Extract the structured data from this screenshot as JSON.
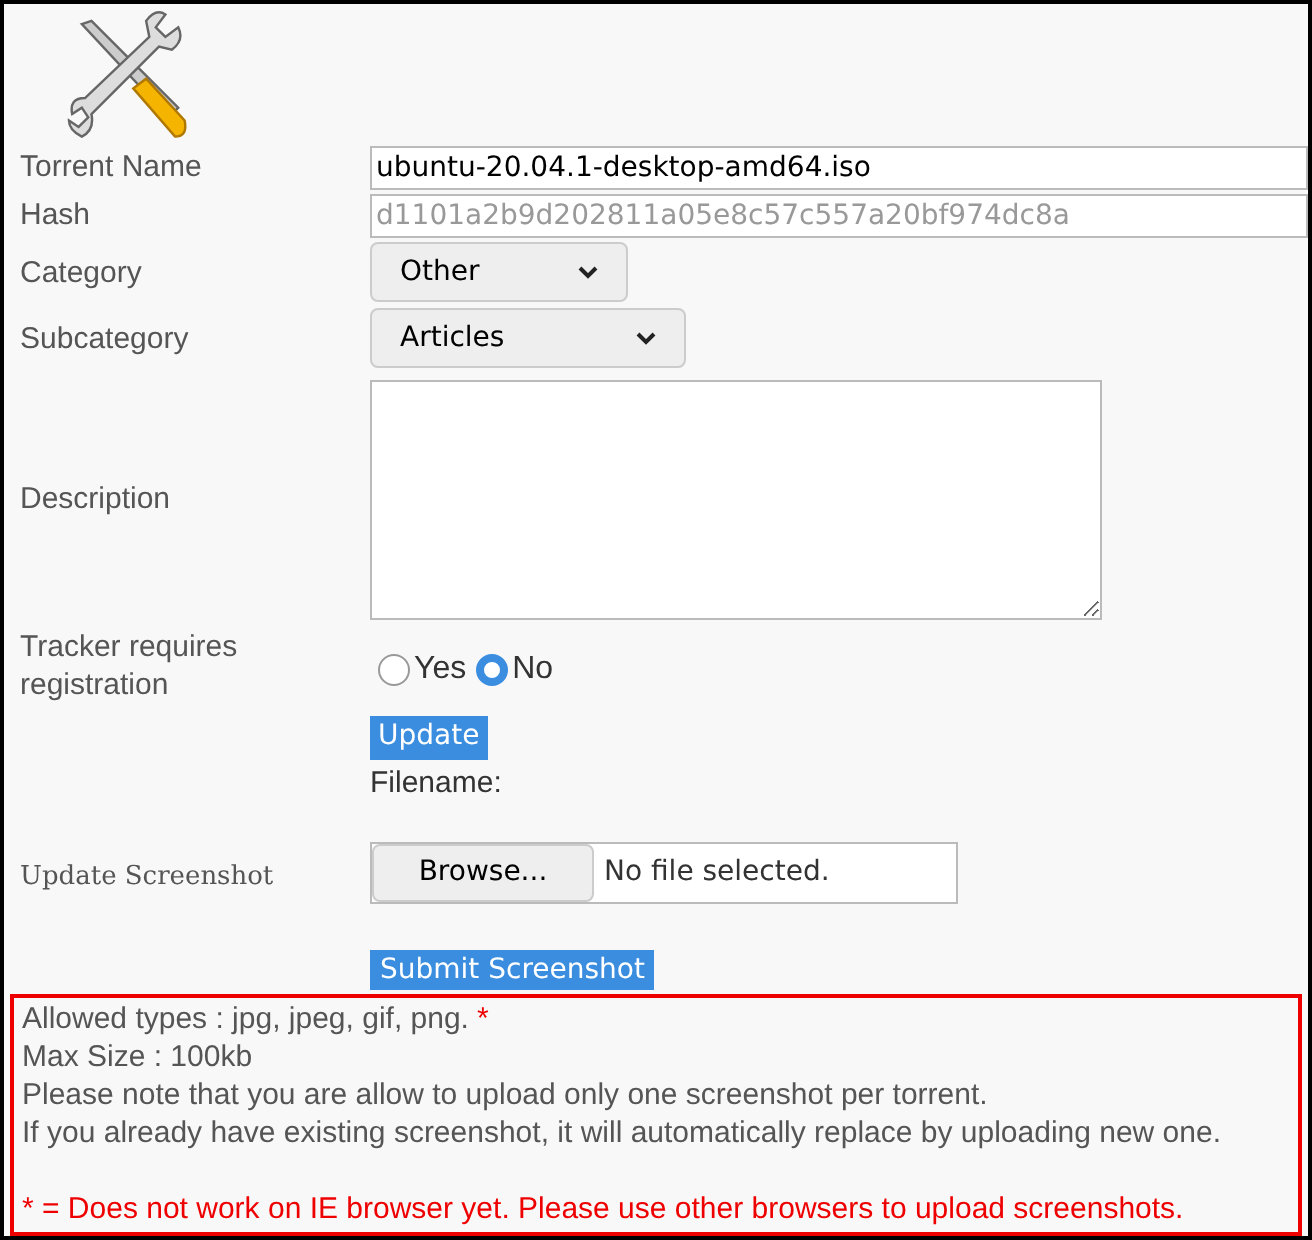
{
  "form": {
    "fields": [
      {
        "kind": "text",
        "label": "Torrent Name",
        "value": "ubuntu-20.04.1-desktop-amd64.iso",
        "disabled": false
      },
      {
        "kind": "text",
        "label": "Hash",
        "value": "d1101a2b9d202811a05e8c57c557a20bf974dc8a",
        "disabled": true
      },
      {
        "kind": "select",
        "label": "Category",
        "value": "Other"
      },
      {
        "kind": "select",
        "label": "Subcategory",
        "value": "Articles"
      },
      {
        "kind": "textarea",
        "label": "Description"
      },
      {
        "kind": "radio",
        "label": "Tracker requires registration",
        "options": [
          {
            "label": "Yes",
            "selected": false
          },
          {
            "label": "No",
            "selected": true
          }
        ]
      }
    ],
    "update_button": "Update",
    "filename_label": "Filename:"
  },
  "screenshot": {
    "label": "Update Screenshot",
    "browse_button": "Browse...",
    "file_status": "No file selected.",
    "submit_button": "Submit Screenshot"
  },
  "notice": {
    "lines": [
      {
        "kind": "plain",
        "text": "Allowed types : jpg, jpeg, gif, png.",
        "mark": "*"
      },
      {
        "kind": "plain",
        "text": "Max Size : 100kb"
      },
      {
        "kind": "plain",
        "text": "Please note that you are allow to upload only one screenshot per torrent."
      },
      {
        "kind": "plain",
        "text": "If you already have existing screenshot, it will automatically replace by uploading new one."
      },
      {
        "kind": "warning",
        "text": "* = Does not work on IE browser yet. Please use other browsers to upload screenshots."
      }
    ]
  }
}
